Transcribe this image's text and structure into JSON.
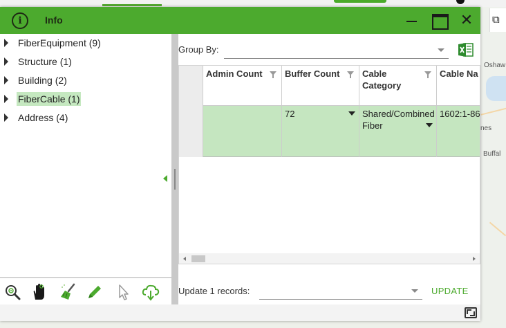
{
  "window": {
    "title": "Info",
    "info_icon": "info-circle-icon"
  },
  "tree": {
    "items": [
      {
        "label": "FiberEquipment (9)",
        "selected": false
      },
      {
        "label": "Structure (1)",
        "selected": false
      },
      {
        "label": "Building (2)",
        "selected": false
      },
      {
        "label": "FiberCable (1)",
        "selected": true
      },
      {
        "label": "Address (4)",
        "selected": false
      }
    ]
  },
  "toolbar": {
    "icons": [
      "zoom-to-icon",
      "pan-hand-icon",
      "clear-broom-icon",
      "edit-pencil-icon",
      "select-pointer-icon",
      "download-cloud-icon"
    ]
  },
  "group_by": {
    "label": "Group By:",
    "value": ""
  },
  "grid": {
    "columns": [
      {
        "label": "Admin Count"
      },
      {
        "label": "Buffer Count"
      },
      {
        "label": "Cable Category"
      },
      {
        "label": "Cable Na"
      }
    ],
    "rows": [
      {
        "cells": [
          "",
          "72",
          "Shared/Combined Fiber",
          "1602:1-86"
        ]
      }
    ]
  },
  "update": {
    "label": "Update 1 records:",
    "value": "",
    "button": "UPDATE"
  },
  "map_labels": {
    "a": "Oshaw",
    "b": "nes",
    "c": "Buffal"
  },
  "colors": {
    "accent": "#4caa2e",
    "selected_row": "#c5e6c0",
    "tree_selected": "#c5e8c0"
  }
}
